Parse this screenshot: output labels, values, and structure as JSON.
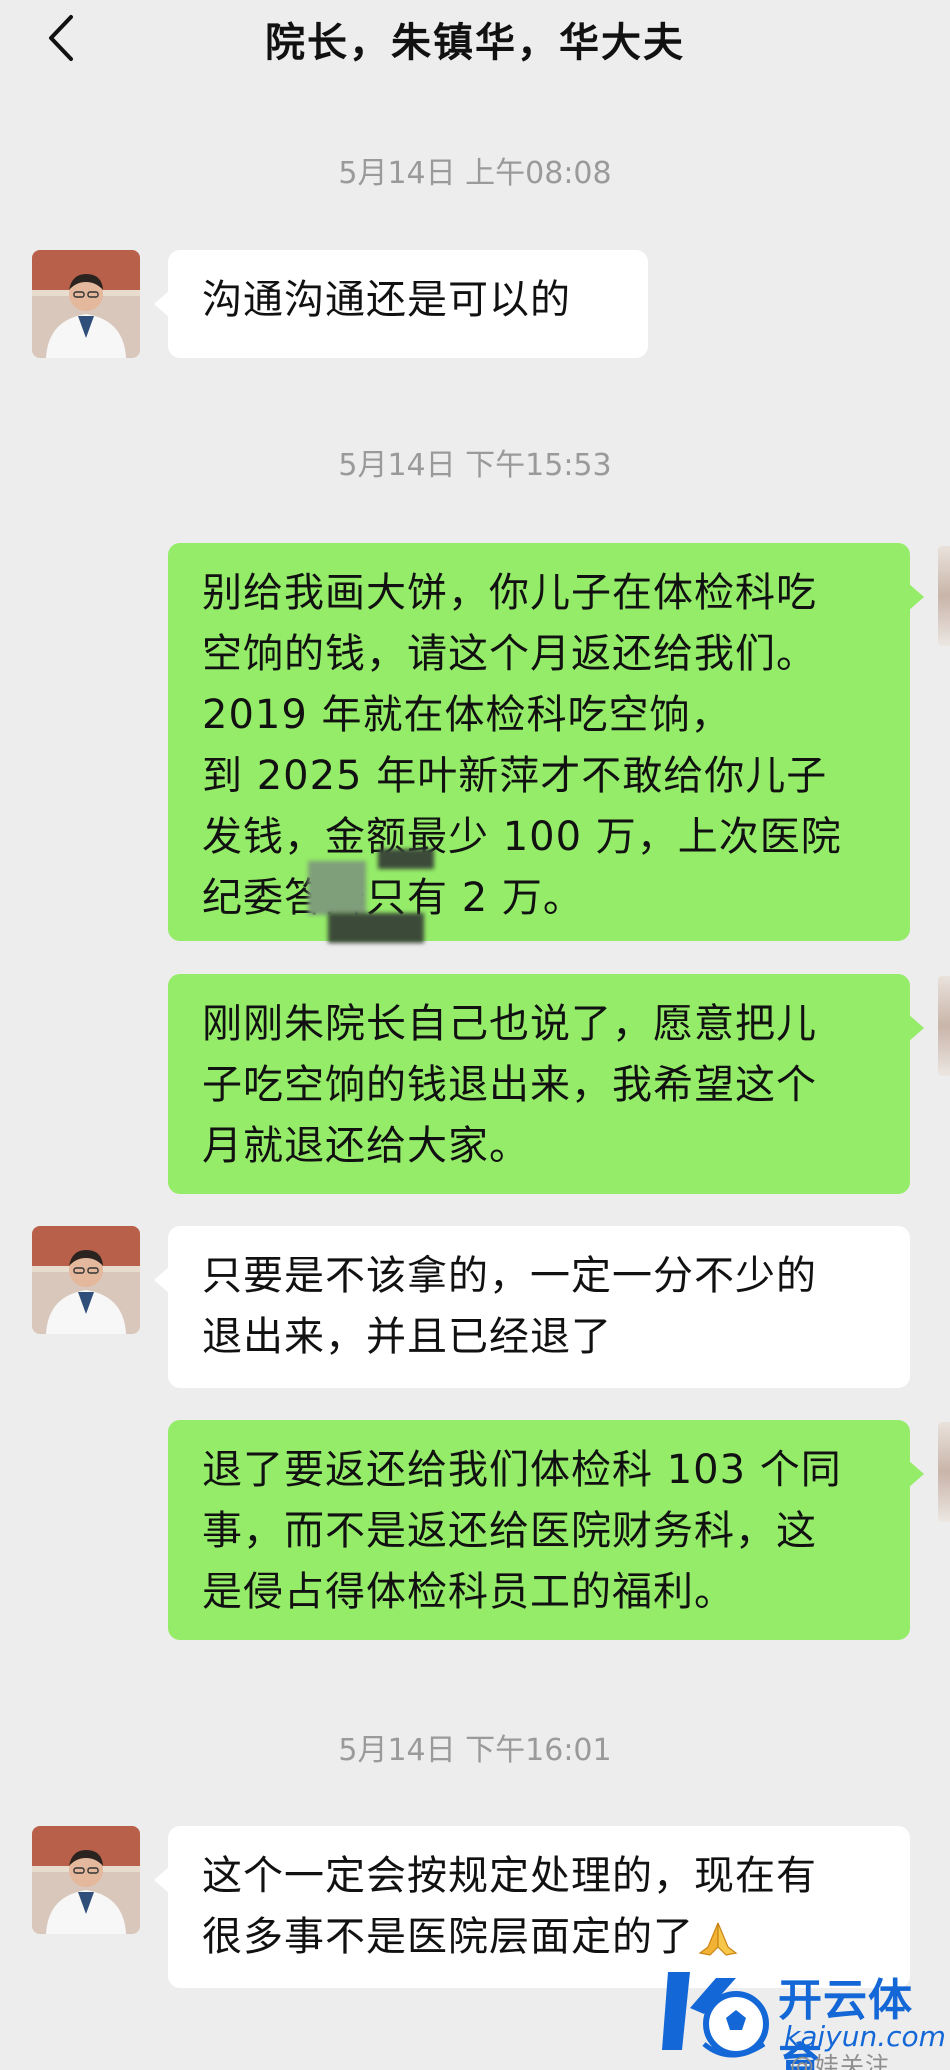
{
  "header": {
    "title": "院长，朱镇华，华大夫"
  },
  "timestamps": [
    "5月14日 上午08:08",
    "5月14日 下午15:53",
    "5月14日 下午16:01"
  ],
  "messages": [
    {
      "from": "other",
      "lines": [
        "沟通沟通还是可以的"
      ]
    },
    {
      "from": "me",
      "lines": [
        "别给我画大饼，你儿子在体检科吃",
        "空饷的钱，请这个月返还给我们。",
        "2019 年就在体检科吃空饷，",
        "到 2025 年叶新萍才不敢给你儿子",
        "发钱，金额最少 100 万，上次医院",
        "纪委答辩只有 2 万。"
      ]
    },
    {
      "from": "me",
      "lines": [
        "刚刚朱院长自己也说了，愿意把儿",
        "子吃空饷的钱退出来，我希望这个",
        "月就退还给大家。"
      ]
    },
    {
      "from": "other",
      "lines": [
        "只要是不该拿的，一定一分不少的",
        "退出来，并且已经退了"
      ]
    },
    {
      "from": "me",
      "lines": [
        "退了要返还给我们体检科 103 个同",
        "事，而不是返还给医院财务科，这",
        "是侵占得体检科员工的福利。"
      ]
    },
    {
      "from": "other",
      "lines": [
        "这个一定会按规定处理的，现在有",
        "很多事不是医院层面定的了"
      ]
    }
  ],
  "icons": {
    "back": "chevron-left-icon",
    "emoji": "praying-hands-emoji",
    "avatar": "doctor-avatar"
  },
  "colors": {
    "background": "#ededed",
    "incoming_bubble": "#ffffff",
    "outgoing_bubble": "#95ec69",
    "timestamp": "#9a9a9a",
    "watermark": "#1467d6"
  },
  "watermark": {
    "brand_cn": "开云体育",
    "brand_en": "kaiyun.com",
    "weibo": "@娃关注"
  }
}
